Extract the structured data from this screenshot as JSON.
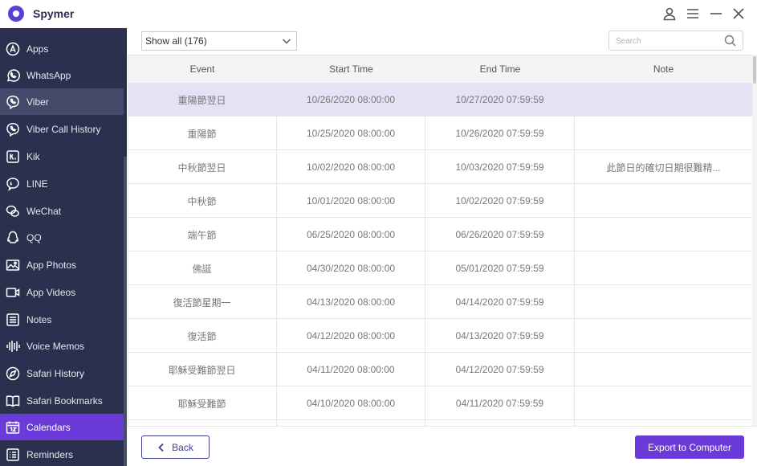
{
  "app": {
    "title": "Spymer"
  },
  "window_controls": [
    "user-icon",
    "menu-icon",
    "minimize-icon",
    "close-icon"
  ],
  "sidebar": {
    "items": [
      {
        "label": "Apps",
        "icon": "apps-icon"
      },
      {
        "label": "WhatsApp",
        "icon": "whatsapp-icon"
      },
      {
        "label": "Viber",
        "icon": "viber-icon",
        "state": "hover"
      },
      {
        "label": "Viber Call History",
        "icon": "viber-icon"
      },
      {
        "label": "Kik",
        "icon": "kik-icon"
      },
      {
        "label": "LINE",
        "icon": "line-icon"
      },
      {
        "label": "WeChat",
        "icon": "wechat-icon"
      },
      {
        "label": "QQ",
        "icon": "qq-icon"
      },
      {
        "label": "App Photos",
        "icon": "photo-icon"
      },
      {
        "label": "App Videos",
        "icon": "video-icon"
      },
      {
        "label": "Notes",
        "icon": "notes-icon"
      },
      {
        "label": "Voice Memos",
        "icon": "voice-memo-icon"
      },
      {
        "label": "Safari History",
        "icon": "safari-icon"
      },
      {
        "label": "Safari Bookmarks",
        "icon": "bookmark-icon"
      },
      {
        "label": "Calendars",
        "icon": "calendar-icon",
        "state": "active"
      },
      {
        "label": "Reminders",
        "icon": "reminders-icon"
      }
    ]
  },
  "filter": {
    "selected": "Show all (176)"
  },
  "search": {
    "placeholder": "Search"
  },
  "table": {
    "columns": [
      "Event",
      "Start Time",
      "End Time",
      "Note"
    ],
    "rows": [
      {
        "event": "重陽節翌日",
        "start": "10/26/2020 08:00:00",
        "end": "10/27/2020 07:59:59",
        "note": "",
        "selected": true
      },
      {
        "event": "重陽節",
        "start": "10/25/2020 08:00:00",
        "end": "10/26/2020 07:59:59",
        "note": ""
      },
      {
        "event": "中秋節翌日",
        "start": "10/02/2020 08:00:00",
        "end": "10/03/2020 07:59:59",
        "note": "此節日的確切日期很難精..."
      },
      {
        "event": "中秋節",
        "start": "10/01/2020 08:00:00",
        "end": "10/02/2020 07:59:59",
        "note": ""
      },
      {
        "event": "端午節",
        "start": "06/25/2020 08:00:00",
        "end": "06/26/2020 07:59:59",
        "note": ""
      },
      {
        "event": "佛誕",
        "start": "04/30/2020 08:00:00",
        "end": "05/01/2020 07:59:59",
        "note": ""
      },
      {
        "event": "復活節星期一",
        "start": "04/13/2020 08:00:00",
        "end": "04/14/2020 07:59:59",
        "note": ""
      },
      {
        "event": "復活節",
        "start": "04/12/2020 08:00:00",
        "end": "04/13/2020 07:59:59",
        "note": ""
      },
      {
        "event": "耶穌受難節翌日",
        "start": "04/11/2020 08:00:00",
        "end": "04/12/2020 07:59:59",
        "note": ""
      },
      {
        "event": "耶穌受難節",
        "start": "04/10/2020 08:00:00",
        "end": "04/11/2020 07:59:59",
        "note": ""
      },
      {
        "event": "",
        "start": "",
        "end": "",
        "note": ""
      }
    ]
  },
  "footer": {
    "back_label": "Back",
    "export_label": "Export to Computer"
  },
  "colors": {
    "sidebar_bg": "#2c304f",
    "accent": "#6a3bd8",
    "selected_row": "#e7e1f5"
  }
}
